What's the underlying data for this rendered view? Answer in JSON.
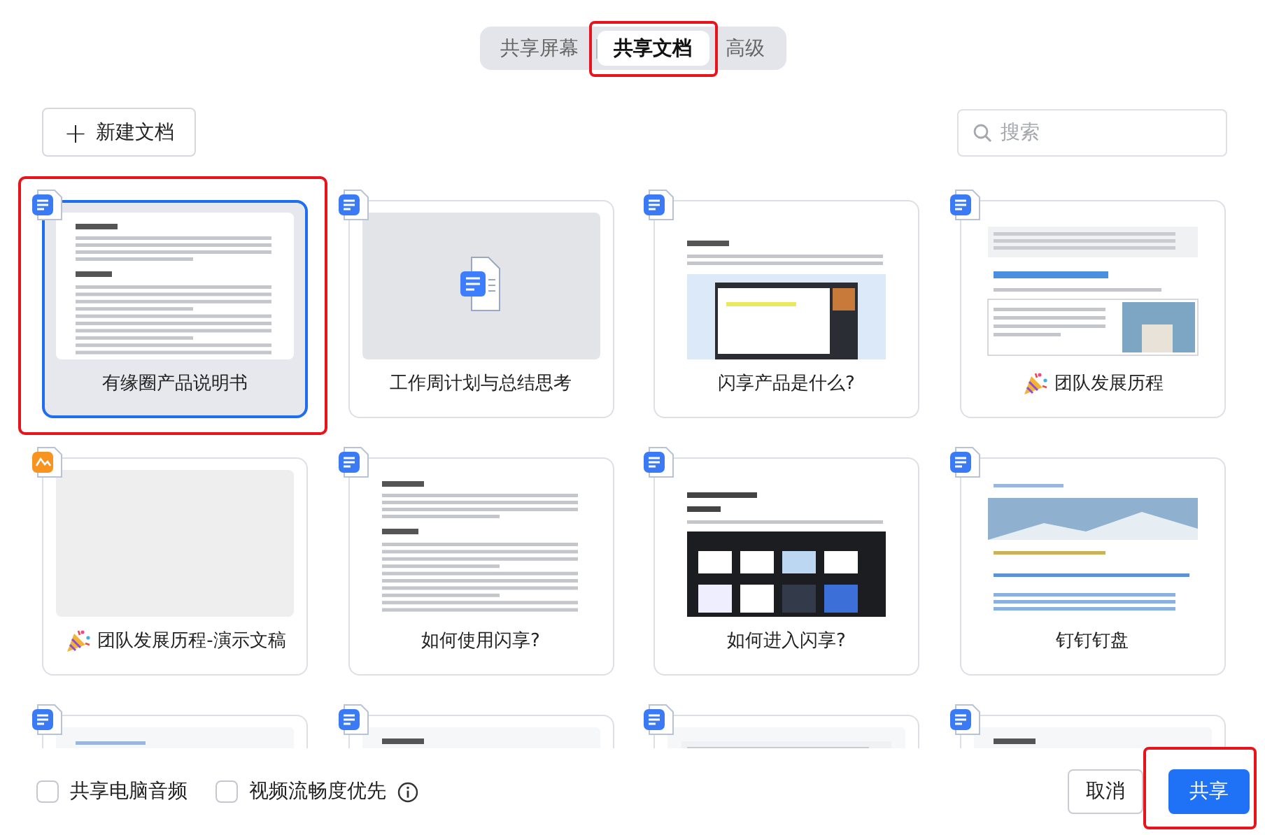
{
  "tabs": [
    {
      "label": "共享屏幕",
      "selected": false,
      "highlighted": false
    },
    {
      "label": "共享文档",
      "selected": true,
      "highlighted": true
    },
    {
      "label": "高级",
      "selected": false,
      "highlighted": false
    }
  ],
  "new_doc_button": {
    "icon": "+",
    "label": "新建文档"
  },
  "search": {
    "placeholder": "搜索"
  },
  "cards": [
    {
      "title": "有缘圈产品说明书",
      "kind": "doc",
      "selected": true,
      "highlighted": true
    },
    {
      "title": "工作周计划与总结思考",
      "kind": "doc",
      "selected": false,
      "highlighted": false
    },
    {
      "title": "闪享产品是什么?",
      "kind": "doc",
      "selected": false,
      "highlighted": false
    },
    {
      "title": "团队发展历程",
      "kind": "doc",
      "party_icon": true,
      "selected": false,
      "highlighted": false
    },
    {
      "title": "团队发展历程-演示文稿",
      "kind": "slides",
      "party_icon": true,
      "selected": false,
      "highlighted": false
    },
    {
      "title": "如何使用闪享?",
      "kind": "doc",
      "selected": false,
      "highlighted": false
    },
    {
      "title": "如何进入闪享?",
      "kind": "doc",
      "selected": false,
      "highlighted": false
    },
    {
      "title": "钉钉钉盘",
      "kind": "doc",
      "selected": false,
      "highlighted": false
    },
    {
      "kind": "doc",
      "selected": false,
      "highlighted": false
    },
    {
      "kind": "doc",
      "selected": false,
      "highlighted": false
    },
    {
      "kind": "doc",
      "selected": false,
      "highlighted": false
    },
    {
      "kind": "doc",
      "selected": false,
      "highlighted": false
    }
  ],
  "options": [
    {
      "label": "共享电脑音频",
      "checked": false
    },
    {
      "label": "视频流畅度优先",
      "checked": false
    }
  ],
  "buttons": [
    {
      "label": "取消",
      "kind": "secondary",
      "highlighted": false
    },
    {
      "label": "共享",
      "kind": "primary",
      "highlighted": true
    }
  ]
}
